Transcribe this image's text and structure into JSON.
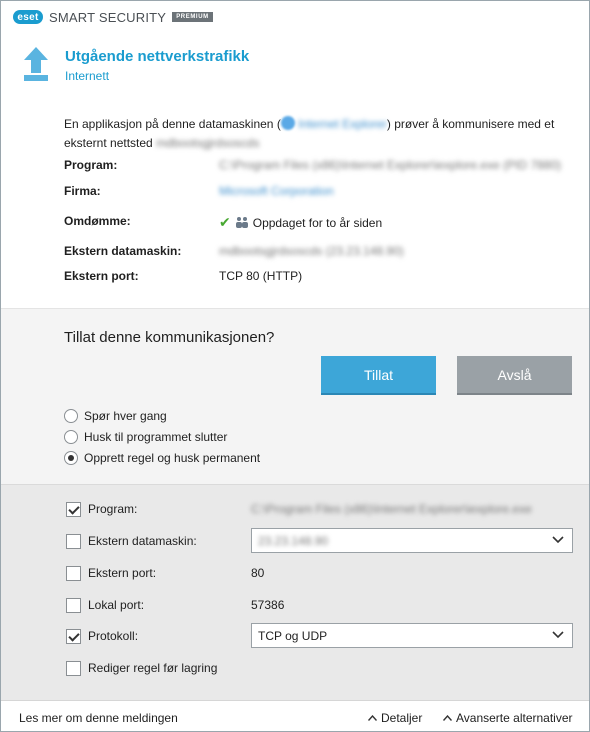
{
  "window": {
    "logo_text": "eset",
    "product_name": "SMART SECURITY",
    "edition": "PREMIUM"
  },
  "alert": {
    "title": "Utgående nettverkstrafikk",
    "subtitle": "Internett",
    "message_part1": "En applikasjon på denne datamaskinen (",
    "app_name": "Internet Explorer",
    "message_part2": ") prøver å kommunisere med et eksternt nettsted",
    "remote_site": "mdbootsgjrdsoscds",
    "arrow_color": "#5ab4e0"
  },
  "details": {
    "program_label": "Program:",
    "program_value": "C:\\Program Files (x86)\\Internet Explorer\\iexplore.exe (PID 7880)",
    "company_label": "Firma:",
    "company_value": "Microsoft Corporation",
    "reputation_label": "Omdømme:",
    "reputation_value": "Oppdaget for to år siden",
    "remote_host_label": "Ekstern datamaskin:",
    "remote_host_value": "mdbootsgjrdsoscds (23.23.148.90)",
    "remote_port_label": "Ekstern port:",
    "remote_port_value": "TCP 80 (HTTP)"
  },
  "decision": {
    "question": "Tillat denne kommunikasjonen?",
    "allow_label": "Tillat",
    "deny_label": "Avslå",
    "options": [
      {
        "label": "Spør hver gang",
        "selected": false
      },
      {
        "label": "Husk til programmet slutter",
        "selected": false
      },
      {
        "label": "Opprett regel og husk permanent",
        "selected": true
      }
    ]
  },
  "rules": {
    "program_label": "Program:",
    "program_checked": true,
    "program_value": "C:\\Program Files (x86)\\Internet Explorer\\iexplore.exe",
    "remote_host_label": "Ekstern datamaskin:",
    "remote_host_checked": false,
    "remote_host_value": "23.23.148.90",
    "remote_port_label": "Ekstern port:",
    "remote_port_checked": false,
    "remote_port_value": "80",
    "local_port_label": "Lokal port:",
    "local_port_checked": false,
    "local_port_value": "57386",
    "protocol_label": "Protokoll:",
    "protocol_checked": true,
    "protocol_value": "TCP og UDP",
    "edit_rule_label": "Rediger regel før lagring",
    "edit_rule_checked": false
  },
  "footer": {
    "learn_more": "Les mer om denne meldingen",
    "details": "Detaljer",
    "advanced": "Avanserte alternativer"
  }
}
